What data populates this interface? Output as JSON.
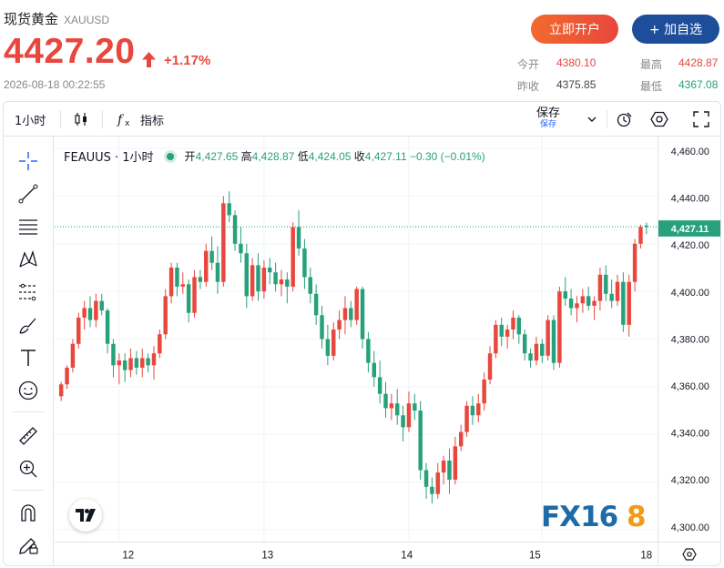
{
  "header": {
    "name": "现货黄金",
    "symbol": "XAUUSD",
    "price": "4427.20",
    "change_pct": "+1.17%",
    "time": "2026-08-18 00:22:55"
  },
  "buttons": {
    "open_account": "立即开户",
    "add_favorite": "+ 加自选"
  },
  "stats": {
    "open_label": "今开",
    "open": "4380.10",
    "high_label": "最高",
    "high": "4428.87",
    "prev_label": "昨收",
    "prev": "4375.85",
    "low_label": "最低",
    "low": "4367.08"
  },
  "toolbar": {
    "interval": "1小时",
    "indicators": "指标",
    "save": "保存",
    "save_sub": "保存"
  },
  "legend": {
    "symbol": "FEAUUS · 1小时",
    "open_k": "开",
    "open_v": "4,427.65",
    "high_k": "高",
    "high_v": "4,428.87",
    "low_k": "低",
    "low_v": "4,424.05",
    "close_k": "收",
    "close_v": "4,427.11",
    "change": "−0.30 (−0.01%)"
  },
  "watermark": "FX168",
  "colors": {
    "up": "#e8473d",
    "down": "#26a17b",
    "accent": "#1e4d9a"
  },
  "chart_data": {
    "type": "candlestick",
    "interval": "1小时",
    "x_ticks": [
      "12",
      "13",
      "14",
      "15",
      "18"
    ],
    "y_ticks": [
      "4,460.00",
      "4,440.00",
      "4,420.00",
      "4,400.00",
      "4,380.00",
      "4,360.00",
      "4,340.00",
      "4,320.00",
      "4,300.00"
    ],
    "ylim": [
      4295,
      4465
    ],
    "last_price_label": "4,427.11",
    "last_price": 4427.11,
    "candles": [
      [
        4356,
        4362,
        4354,
        4361
      ],
      [
        4361,
        4369,
        4359,
        4368
      ],
      [
        4368,
        4380,
        4366,
        4378
      ],
      [
        4378,
        4391,
        4376,
        4389
      ],
      [
        4389,
        4396,
        4384,
        4393
      ],
      [
        4393,
        4398,
        4385,
        4388
      ],
      [
        4388,
        4399,
        4385,
        4396
      ],
      [
        4396,
        4399,
        4390,
        4392
      ],
      [
        4392,
        4393,
        4374,
        4378
      ],
      [
        4378,
        4380,
        4364,
        4369
      ],
      [
        4369,
        4374,
        4361,
        4371
      ],
      [
        4371,
        4374,
        4362,
        4367
      ],
      [
        4367,
        4376,
        4364,
        4372
      ],
      [
        4372,
        4375,
        4365,
        4368
      ],
      [
        4368,
        4376,
        4364,
        4372
      ],
      [
        4372,
        4374,
        4366,
        4369
      ],
      [
        4369,
        4377,
        4363,
        4374
      ],
      [
        4374,
        4384,
        4372,
        4382
      ],
      [
        4382,
        4401,
        4380,
        4398
      ],
      [
        4398,
        4412,
        4395,
        4410
      ],
      [
        4410,
        4412,
        4398,
        4402
      ],
      [
        4402,
        4408,
        4399,
        4403
      ],
      [
        4403,
        4405,
        4387,
        4391
      ],
      [
        4391,
        4409,
        4389,
        4406
      ],
      [
        4406,
        4409,
        4401,
        4404
      ],
      [
        4404,
        4420,
        4402,
        4417
      ],
      [
        4417,
        4423,
        4409,
        4412
      ],
      [
        4412,
        4419,
        4399,
        4404
      ],
      [
        4404,
        4440,
        4402,
        4437
      ],
      [
        4437,
        4442,
        4429,
        4432
      ],
      [
        4432,
        4434,
        4417,
        4420
      ],
      [
        4420,
        4427,
        4412,
        4416
      ],
      [
        4416,
        4420,
        4393,
        4398
      ],
      [
        4398,
        4414,
        4396,
        4411
      ],
      [
        4411,
        4416,
        4396,
        4400
      ],
      [
        4400,
        4413,
        4397,
        4410
      ],
      [
        4410,
        4414,
        4403,
        4408
      ],
      [
        4408,
        4412,
        4400,
        4403
      ],
      [
        4403,
        4409,
        4398,
        4405
      ],
      [
        4405,
        4408,
        4395,
        4402
      ],
      [
        4402,
        4429,
        4400,
        4427
      ],
      [
        4427,
        4434,
        4415,
        4418
      ],
      [
        4418,
        4422,
        4401,
        4406
      ],
      [
        4406,
        4410,
        4395,
        4399
      ],
      [
        4399,
        4403,
        4386,
        4390
      ],
      [
        4390,
        4394,
        4376,
        4380
      ],
      [
        4380,
        4386,
        4369,
        4373
      ],
      [
        4373,
        4387,
        4371,
        4384
      ],
      [
        4384,
        4392,
        4380,
        4388
      ],
      [
        4388,
        4398,
        4382,
        4393
      ],
      [
        4393,
        4396,
        4385,
        4388
      ],
      [
        4388,
        4402,
        4386,
        4401
      ],
      [
        4401,
        4402,
        4376,
        4380
      ],
      [
        4380,
        4383,
        4366,
        4370
      ],
      [
        4370,
        4375,
        4360,
        4364
      ],
      [
        4364,
        4371,
        4353,
        4357
      ],
      [
        4357,
        4362,
        4347,
        4351
      ],
      [
        4351,
        4357,
        4346,
        4353
      ],
      [
        4353,
        4359,
        4344,
        4348
      ],
      [
        4348,
        4352,
        4337,
        4343
      ],
      [
        4343,
        4358,
        4341,
        4353
      ],
      [
        4353,
        4357,
        4346,
        4350
      ],
      [
        4350,
        4354,
        4321,
        4325
      ],
      [
        4325,
        4328,
        4313,
        4318
      ],
      [
        4318,
        4322,
        4311,
        4315
      ],
      [
        4315,
        4328,
        4313,
        4324
      ],
      [
        4324,
        4331,
        4319,
        4329
      ],
      [
        4329,
        4334,
        4315,
        4321
      ],
      [
        4321,
        4339,
        4319,
        4335
      ],
      [
        4335,
        4344,
        4333,
        4341
      ],
      [
        4341,
        4354,
        4339,
        4352
      ],
      [
        4352,
        4356,
        4344,
        4348
      ],
      [
        4348,
        4357,
        4345,
        4353
      ],
      [
        4353,
        4366,
        4350,
        4363
      ],
      [
        4363,
        4377,
        4361,
        4374
      ],
      [
        4374,
        4388,
        4372,
        4386
      ],
      [
        4386,
        4389,
        4377,
        4381
      ],
      [
        4381,
        4386,
        4376,
        4384
      ],
      [
        4384,
        4392,
        4380,
        4389
      ],
      [
        4389,
        4390,
        4378,
        4382
      ],
      [
        4382,
        4384,
        4371,
        4374
      ],
      [
        4374,
        4376,
        4368,
        4371
      ],
      [
        4371,
        4381,
        4369,
        4378
      ],
      [
        4378,
        4380,
        4370,
        4373
      ],
      [
        4373,
        4390,
        4371,
        4388
      ],
      [
        4388,
        4390,
        4367,
        4370
      ],
      [
        4370,
        4402,
        4368,
        4400
      ],
      [
        4400,
        4406,
        4394,
        4397
      ],
      [
        4397,
        4401,
        4390,
        4393
      ],
      [
        4393,
        4398,
        4387,
        4395
      ],
      [
        4395,
        4401,
        4391,
        4398
      ],
      [
        4398,
        4402,
        4392,
        4394
      ],
      [
        4394,
        4398,
        4388,
        4396
      ],
      [
        4396,
        4410,
        4392,
        4407
      ],
      [
        4407,
        4411,
        4396,
        4399
      ],
      [
        4399,
        4405,
        4393,
        4396
      ],
      [
        4396,
        4407,
        4394,
        4404
      ],
      [
        4404,
        4408,
        4383,
        4386
      ],
      [
        4386,
        4407,
        4381,
        4404
      ],
      [
        4404,
        4422,
        4400,
        4420
      ],
      [
        4420,
        4428,
        4418,
        4427
      ],
      [
        4427.65,
        4428.87,
        4424.05,
        4427.11
      ]
    ]
  }
}
